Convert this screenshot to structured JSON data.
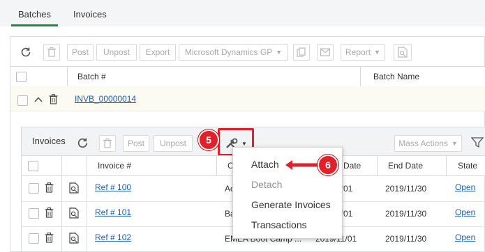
{
  "tabs": [
    {
      "label": "Batches",
      "active": true
    },
    {
      "label": "Invoices",
      "active": false
    }
  ],
  "toolbar": {
    "post": "Post",
    "unpost": "Unpost",
    "export": "Export",
    "integration": "Microsoft Dynamics GP",
    "report": "Report"
  },
  "batch_table": {
    "columns": [
      "Batch #",
      "Batch Name"
    ],
    "row": {
      "batch_no": "INVB_00000014"
    }
  },
  "invoices": {
    "title": "Invoices",
    "post": "Post",
    "unpost": "Unpost",
    "mass_actions": "Mass Actions",
    "columns": {
      "invoice_no": "Invoice #",
      "c": "C",
      "start_date_partial": "Date",
      "end_date": "End Date",
      "state": "State"
    },
    "rows": [
      {
        "ref": "Ref # 100",
        "c": "Ac",
        "start": "1/01",
        "end": "2019/11/30",
        "state": "Open"
      },
      {
        "ref": "Ref # 101",
        "c": "Ba",
        "start": "1/01",
        "end": "2019/11/30",
        "state": "Open"
      },
      {
        "ref": "Ref # 102",
        "c": "EMEA Boot Camp ...",
        "start": "2019/11/01",
        "end": "2019/11/30",
        "state": "Open"
      }
    ]
  },
  "menu": {
    "items": [
      {
        "label": "Attach",
        "disabled": false
      },
      {
        "label": "Detach",
        "disabled": true
      },
      {
        "label": "Generate Invoices",
        "disabled": false
      },
      {
        "label": "Transactions",
        "disabled": false
      }
    ]
  },
  "callouts": {
    "step5": "5",
    "step6": "6"
  },
  "colors": {
    "accent_green": "#1e8a3c",
    "link_blue": "#1a5fb4",
    "callout_red": "#e0202b"
  }
}
